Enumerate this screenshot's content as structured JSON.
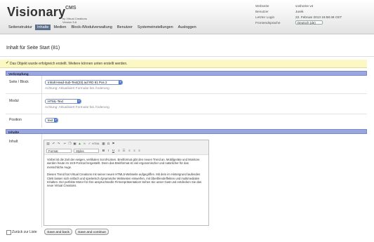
{
  "header": {
    "logo": "Visionary",
    "logo_sup": "CMS",
    "by_line1": "by Virtual Creations",
    "by_line2": "Version 5.8",
    "nav": [
      "Seitenstruktur",
      "Inhalte",
      "Medien",
      "Block-/Modulverwaltung",
      "Benutzer",
      "Systemeinstellungen",
      "Ausloggen"
    ],
    "active_nav": "Inhalte",
    "info": {
      "website_label": "Webseite",
      "website_value": "voshome v4",
      "user_label": "Benutzer",
      "user_value": "Jurek",
      "login_label": "Letzter Login",
      "login_value": "22. Februar 2013 15:58:48 CET",
      "lang_label": "Frontendsprache",
      "lang_value": "Deutsch (de)"
    }
  },
  "page": {
    "title": "Inhalt für Seite Start (81)",
    "success_message": "Das Objekt wurde erfolgreich erstellt. Weitere können unten erstellt werden."
  },
  "verknuepfung": {
    "section_title": "Verknüpfung",
    "seite_label": "Seite / Block",
    "seite_value": "Inhalt Head-Sub-Text(23) auf RD 81 Pos 2",
    "seite_hint": "Achtung: Aktualisiert Formular bei Änderung",
    "modul_label": "Modul",
    "modul_value": "HTML-Text",
    "modul_hint": "Achtung: Aktualisiert Formular bei Änderung",
    "position_label": "Position",
    "position_value": "text"
  },
  "inhalte": {
    "section_title": "Inhalte",
    "inhalt_label": "Inhalt",
    "format_label": "Format",
    "styles_label": "Styles",
    "html_label": "HTML",
    "paragraph1": "Vorbei ist die Zeit der ewigen, vertikalen Scroll-Listen. Breitformat gibt den neuen Trend an. Mobilgeräte und Monitore werden heute im 16:9-Format hergestellt. Denn das Breitformat ist viel ergonomischer und natürlicher für das menschliche Auge.",
    "paragraph2": "Diesen Trend hat Virtual Creations mit seiner neuen HTML5-Webseite aufgegriffen. Mit dem im Hintergrund laufenden CMS lassen sich einfach und spielerisch dynamische Webseiten entwerfen, mit Überblendeffekten und multimedialen Inhalten. Der perfekte Motor für Ihre anspruchsvolle Firmenpräsentation! Sehen Sie unser Gast und entdecken Sie das neue Virtual Creations."
  },
  "footer": {
    "back_label": "Zurück zur Liste",
    "save_back_label": "Save and back",
    "save_continue_label": "Save and continue"
  }
}
